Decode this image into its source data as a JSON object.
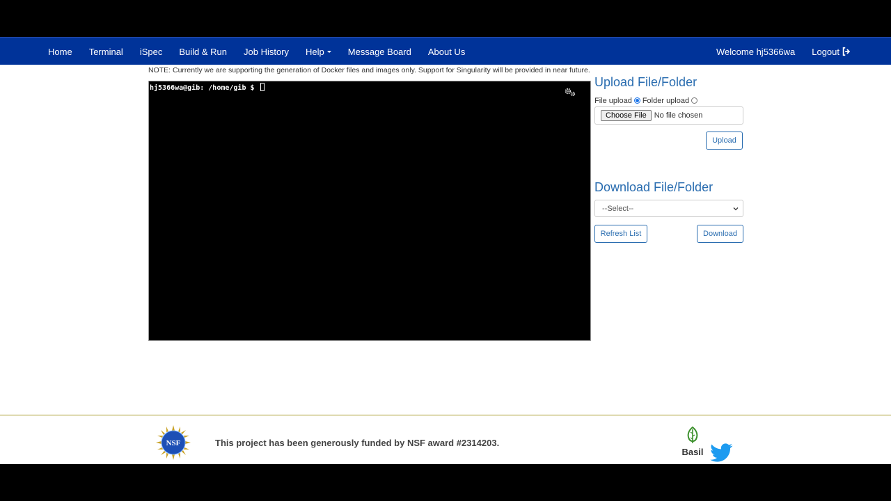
{
  "nav": {
    "items": [
      {
        "label": "Home"
      },
      {
        "label": "Terminal"
      },
      {
        "label": "iSpec"
      },
      {
        "label": "Build & Run"
      },
      {
        "label": "Job History"
      },
      {
        "label": "Help"
      },
      {
        "label": "Message Board"
      },
      {
        "label": "About Us"
      }
    ],
    "welcome": "Welcome hj5366wa",
    "logout": "Logout"
  },
  "note": "NOTE: Currently we are supporting the generation of Docker files and images only. Support for Singularity will be provided in near future.",
  "terminal": {
    "prompt": "hj5366wa@gib: /home/gib $"
  },
  "upload": {
    "title": "Upload File/Folder",
    "file_upload_label": "File upload",
    "folder_upload_label": "Folder upload",
    "choose_file_label": "Choose File",
    "no_file_text": "No file chosen",
    "upload_button": "Upload"
  },
  "download": {
    "title": "Download File/Folder",
    "select_value": "--Select--",
    "refresh_button": "Refresh List",
    "download_button": "Download"
  },
  "footer": {
    "funding_text": "This project has been generously funded by NSF award #2314203.",
    "basil_label": "Basil",
    "nsf_logo_text": "NSF"
  },
  "colors": {
    "navbar": "#003399",
    "accent": "#2a6db0"
  }
}
